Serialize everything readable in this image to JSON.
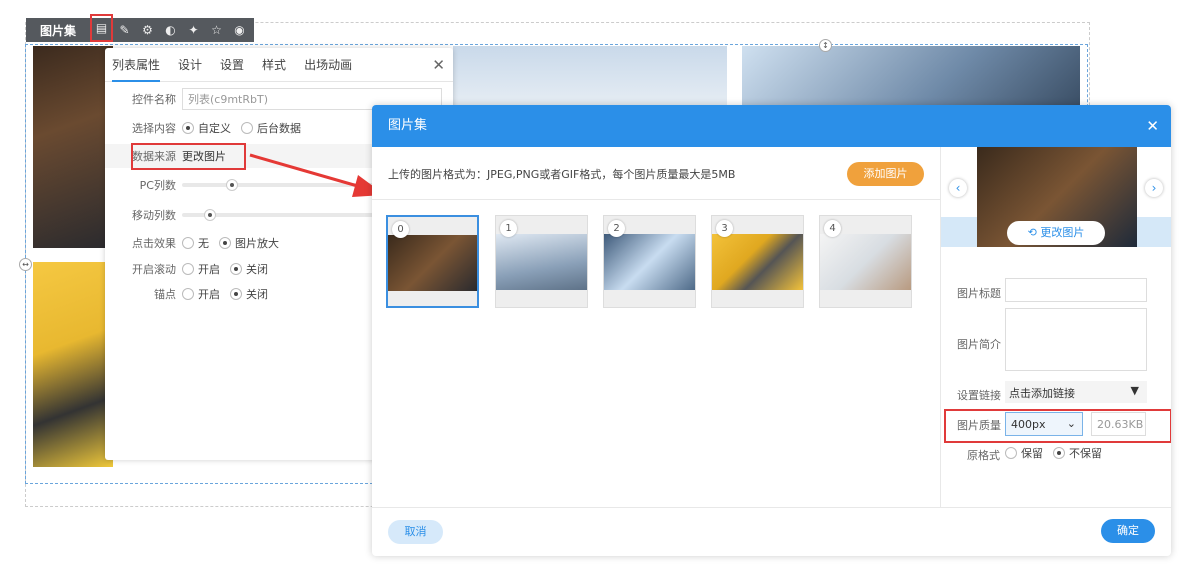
{
  "toolbar": {
    "title": "图片集",
    "icons": [
      "list-settings-icon",
      "magic-wand-icon",
      "gear-icon",
      "palette-icon",
      "sparkle-icon",
      "star-icon",
      "eye-icon"
    ]
  },
  "panel": {
    "tabs": [
      "列表属性",
      "设计",
      "设置",
      "样式",
      "出场动画"
    ],
    "close": "✕",
    "control_name_label": "控件名称",
    "control_name_value": "列表(c9mtRbT)",
    "content_label": "选择内容",
    "content_options": [
      "自定义",
      "后台数据"
    ],
    "source_label": "数据来源",
    "source_button": "更改图片",
    "pc_cols_label": "PC列数",
    "pc_cols_value": 0.25,
    "mobile_cols_label": "移动列数",
    "mobile_cols_value": 0.15,
    "click_label": "点击效果",
    "click_options": [
      "无",
      "图片放大"
    ],
    "scroll_label": "开启滚动",
    "scroll_options": [
      "开启",
      "关闭"
    ],
    "anchor_label": "锚点",
    "anchor_options": [
      "开启",
      "关闭"
    ]
  },
  "modal": {
    "title": "图片集",
    "close": "✕",
    "hint": "上传的图片格式为：JPEG,PNG或者GIF格式，每个图片质量最大是5MB",
    "add_button": "添加图片",
    "thumbs": [
      "0",
      "1",
      "2",
      "3",
      "4"
    ],
    "change_button": "更改图片",
    "title_label": "图片标题",
    "title_value": "",
    "desc_label": "图片简介",
    "desc_value": "",
    "link_label": "设置链接",
    "link_value": "点击添加链接",
    "quality_label": "图片质量",
    "quality_value": "400px",
    "quality_size": "20.63KB",
    "format_label": "原格式",
    "format_options": [
      "保留",
      "不保留"
    ],
    "cancel": "取消",
    "confirm": "确定"
  }
}
